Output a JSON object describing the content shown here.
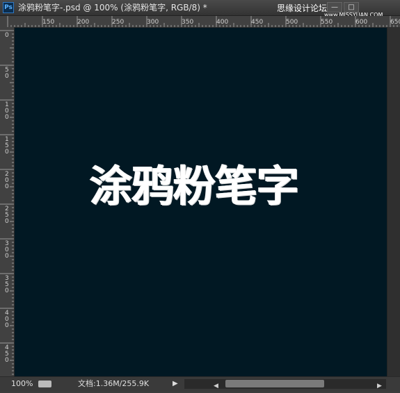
{
  "window": {
    "app_icon": "Ps",
    "title": "涂鸦粉笔字-.psd @ 100% (涂鸦粉笔字, RGB/8) *",
    "watermark": "思缘设计论坛",
    "watermark_sub": "www.MISSYUAN.COM",
    "minimize_label": "—",
    "maximize_label": "□"
  },
  "ruler_top": {
    "labels": [
      "150",
      "200",
      "250",
      "300",
      "350",
      "400",
      "450",
      "500",
      "550",
      "600",
      "650"
    ]
  },
  "ruler_left": {
    "labels": [
      "0",
      "50",
      "100",
      "150",
      "200",
      "250",
      "300",
      "350",
      "400",
      "450"
    ]
  },
  "canvas": {
    "text": "涂鸦粉笔字",
    "background": "#011823",
    "text_color": "#ffffff"
  },
  "status": {
    "zoom": "100%",
    "doc_info": "文档:1.36M/255.9K",
    "menu_arrow": "▶",
    "scroll_left": "◀",
    "scroll_right": "▶"
  }
}
